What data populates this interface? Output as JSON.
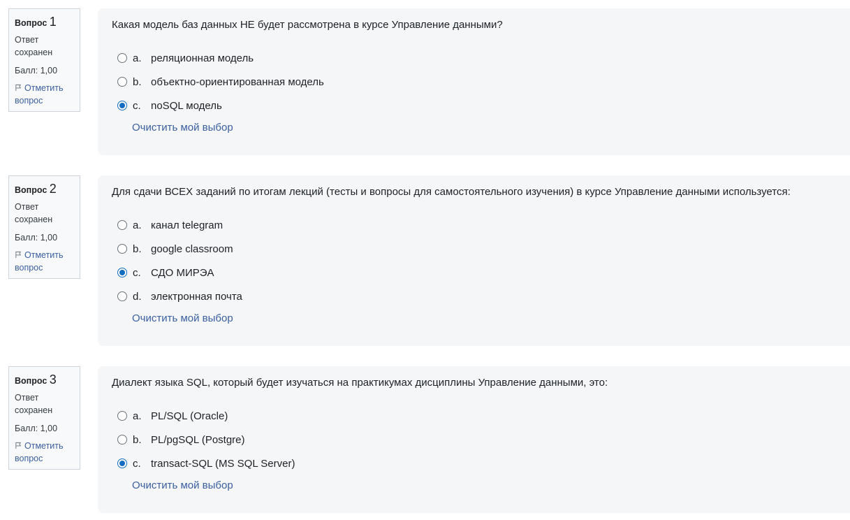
{
  "questions": [
    {
      "word": "Вопрос",
      "number": "1",
      "state": "Ответ сохранен",
      "grade": "Балл: 1,00",
      "flag_label": "Отметить вопрос",
      "text": "Какая модель баз данных НЕ будет рассмотрена в курсе Управление данными?",
      "options": [
        {
          "letter": "a.",
          "label": "реляционная модель",
          "checked": false
        },
        {
          "letter": "b.",
          "label": "объектно-ориентированная модель",
          "checked": false
        },
        {
          "letter": "c.",
          "label": "noSQL модель",
          "checked": true
        }
      ],
      "clear_label": "Очистить мой выбор"
    },
    {
      "word": "Вопрос",
      "number": "2",
      "state": "Ответ сохранен",
      "grade": "Балл: 1,00",
      "flag_label": "Отметить вопрос",
      "text": "Для сдачи ВСЕХ заданий по итогам лекций (тесты и вопросы для самостоятельного изучения) в курсе Управление данными используется:",
      "options": [
        {
          "letter": "a.",
          "label": "канал telegram",
          "checked": false
        },
        {
          "letter": "b.",
          "label": "google classroom",
          "checked": false
        },
        {
          "letter": "c.",
          "label": "СДО МИРЭА",
          "checked": true
        },
        {
          "letter": "d.",
          "label": "электронная почта",
          "checked": false
        }
      ],
      "clear_label": "Очистить мой выбор"
    },
    {
      "word": "Вопрос",
      "number": "3",
      "state": "Ответ сохранен",
      "grade": "Балл: 1,00",
      "flag_label": "Отметить вопрос",
      "text": "Диалект языка SQL, который будет изучаться на практикумах дисциплины Управление данными, это:",
      "options": [
        {
          "letter": "a.",
          "label": "PL/SQL (Oracle)",
          "checked": false
        },
        {
          "letter": "b.",
          "label": "PL/pgSQL (Postgre)",
          "checked": false
        },
        {
          "letter": "c.",
          "label": "transact-SQL (MS SQL Server)",
          "checked": true
        }
      ],
      "clear_label": "Очистить мой выбор"
    }
  ]
}
